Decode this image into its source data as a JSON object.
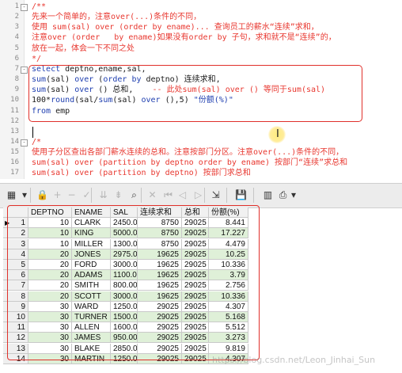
{
  "editor": {
    "lines": [
      {
        "n": "1",
        "fold": "-",
        "segments": [
          {
            "t": "/**",
            "c": "cm"
          }
        ]
      },
      {
        "n": "2",
        "segments": [
          {
            "t": "先来一个简单的，注意over(...)条件的不同，",
            "c": "cm"
          }
        ]
      },
      {
        "n": "3",
        "segments": [
          {
            "t": "使用 sum(sal) over (order by ename)... 查询员工的薪水“连续”求和，",
            "c": "cm"
          }
        ]
      },
      {
        "n": "4",
        "segments": [
          {
            "t": "注意over (order   by ename)如果没有order by 子句，求和就不是“连续”的，",
            "c": "cm"
          }
        ]
      },
      {
        "n": "5",
        "segments": [
          {
            "t": "放在一起，体会一下不同之处",
            "c": "cm"
          }
        ]
      },
      {
        "n": "6",
        "segments": [
          {
            "t": "*/",
            "c": "cm"
          }
        ]
      },
      {
        "n": "7",
        "fold": "-",
        "segments": [
          {
            "t": "select ",
            "c": "kw"
          },
          {
            "t": "deptno,ename,sal,",
            "c": "plain"
          }
        ]
      },
      {
        "n": "8",
        "segments": [
          {
            "t": "sum",
            "c": "fn"
          },
          {
            "t": "(sal) ",
            "c": "plain"
          },
          {
            "t": "over ",
            "c": "kw"
          },
          {
            "t": "(",
            "c": "plain"
          },
          {
            "t": "order by ",
            "c": "kw"
          },
          {
            "t": "deptno) 连续求和,",
            "c": "plain"
          }
        ]
      },
      {
        "n": "9",
        "segments": [
          {
            "t": "sum",
            "c": "fn"
          },
          {
            "t": "(sal) ",
            "c": "plain"
          },
          {
            "t": "over ",
            "c": "kw"
          },
          {
            "t": "() 总和,    ",
            "c": "plain"
          },
          {
            "t": "-- 此处sum(sal) over () 等同于sum(sal)",
            "c": "cm"
          }
        ]
      },
      {
        "n": "10",
        "segments": [
          {
            "t": "100*",
            "c": "plain"
          },
          {
            "t": "round",
            "c": "fn"
          },
          {
            "t": "(sal/",
            "c": "plain"
          },
          {
            "t": "sum",
            "c": "fn"
          },
          {
            "t": "(sal) ",
            "c": "plain"
          },
          {
            "t": "over ",
            "c": "kw"
          },
          {
            "t": "(),5) ",
            "c": "plain"
          },
          {
            "t": "\"份额(%)\"",
            "c": "str"
          }
        ]
      },
      {
        "n": "11",
        "segments": [
          {
            "t": "from ",
            "c": "kw"
          },
          {
            "t": "emp",
            "c": "plain"
          }
        ]
      },
      {
        "n": "12",
        "segments": []
      },
      {
        "n": "13",
        "segments": []
      },
      {
        "n": "14",
        "fold": "-",
        "segments": [
          {
            "t": "/*",
            "c": "cm"
          }
        ]
      },
      {
        "n": "15",
        "segments": [
          {
            "t": "使用子分区查出各部门薪水连续的总和。注意按部门分区。注意over(...)条件的不同，",
            "c": "cm"
          }
        ]
      },
      {
        "n": "16",
        "segments": [
          {
            "t": "sum(sal) over (partition by deptno order by ename) 按部门“连续”求总和",
            "c": "cm"
          }
        ]
      },
      {
        "n": "17",
        "segments": [
          {
            "t": "sum(sal) over (partition by deptno) 按部门求总和",
            "c": "cm"
          }
        ]
      }
    ]
  },
  "toolbar": {
    "buttons": [
      {
        "name": "grid-view-icon",
        "glyph": "▦",
        "enabled": true
      },
      {
        "name": "grid-view-dropdown-icon",
        "glyph": "▾",
        "enabled": true
      },
      {
        "name": "lock-icon",
        "glyph": "🔒",
        "enabled": false
      },
      {
        "name": "add-row-icon",
        "glyph": "+",
        "enabled": false
      },
      {
        "name": "delete-row-icon",
        "glyph": "−",
        "enabled": false
      },
      {
        "name": "post-changes-icon",
        "glyph": "✓",
        "enabled": false
      },
      {
        "name": "fetch-next-icon",
        "glyph": "⇊",
        "enabled": false
      },
      {
        "name": "fetch-all-icon",
        "glyph": "⇟",
        "enabled": false
      },
      {
        "name": "find-icon",
        "glyph": "⌕",
        "enabled": true
      },
      {
        "name": "clear-record-icon",
        "glyph": "✕",
        "enabled": false
      },
      {
        "name": "first-record-icon",
        "glyph": "⏮",
        "enabled": false
      },
      {
        "name": "prev-record-icon",
        "glyph": "◁",
        "enabled": false
      },
      {
        "name": "next-record-icon",
        "glyph": "▷",
        "enabled": false
      },
      {
        "name": "export-icon",
        "glyph": "⇲",
        "enabled": true
      },
      {
        "name": "save-icon",
        "glyph": "💾",
        "enabled": true
      },
      {
        "name": "chart-icon",
        "glyph": "▥",
        "enabled": true
      },
      {
        "name": "print-icon",
        "glyph": "⎙",
        "enabled": true
      },
      {
        "name": "print-dropdown-icon",
        "glyph": "▾",
        "enabled": true
      }
    ]
  },
  "grid": {
    "columns": [
      "",
      "DEPTNO",
      "ENAME",
      "SAL",
      "连续求和",
      "总和",
      "份额(%)"
    ],
    "rows": [
      {
        "i": "1",
        "cur": true,
        "deptno": "10",
        "ename": "CLARK",
        "sal": "2450.00",
        "cum": "8750",
        "total": "29025",
        "pct": "8.441"
      },
      {
        "i": "2",
        "deptno": "10",
        "ename": "KING",
        "sal": "5000.00",
        "cum": "8750",
        "total": "29025",
        "pct": "17.227"
      },
      {
        "i": "3",
        "deptno": "10",
        "ename": "MILLER",
        "sal": "1300.00",
        "cum": "8750",
        "total": "29025",
        "pct": "4.479"
      },
      {
        "i": "4",
        "deptno": "20",
        "ename": "JONES",
        "sal": "2975.00",
        "cum": "19625",
        "total": "29025",
        "pct": "10.25"
      },
      {
        "i": "5",
        "deptno": "20",
        "ename": "FORD",
        "sal": "3000.00",
        "cum": "19625",
        "total": "29025",
        "pct": "10.336"
      },
      {
        "i": "6",
        "deptno": "20",
        "ename": "ADAMS",
        "sal": "1100.00",
        "cum": "19625",
        "total": "29025",
        "pct": "3.79"
      },
      {
        "i": "7",
        "deptno": "20",
        "ename": "SMITH",
        "sal": "800.00",
        "cum": "19625",
        "total": "29025",
        "pct": "2.756"
      },
      {
        "i": "8",
        "deptno": "20",
        "ename": "SCOTT",
        "sal": "3000.00",
        "cum": "19625",
        "total": "29025",
        "pct": "10.336"
      },
      {
        "i": "9",
        "deptno": "30",
        "ename": "WARD",
        "sal": "1250.00",
        "cum": "29025",
        "total": "29025",
        "pct": "4.307"
      },
      {
        "i": "10",
        "deptno": "30",
        "ename": "TURNER",
        "sal": "1500.00",
        "cum": "29025",
        "total": "29025",
        "pct": "5.168"
      },
      {
        "i": "11",
        "deptno": "30",
        "ename": "ALLEN",
        "sal": "1600.00",
        "cum": "29025",
        "total": "29025",
        "pct": "5.512"
      },
      {
        "i": "12",
        "deptno": "30",
        "ename": "JAMES",
        "sal": "950.00",
        "cum": "29025",
        "total": "29025",
        "pct": "3.273"
      },
      {
        "i": "13",
        "deptno": "30",
        "ename": "BLAKE",
        "sal": "2850.00",
        "cum": "29025",
        "total": "29025",
        "pct": "9.819"
      },
      {
        "i": "14",
        "deptno": "30",
        "ename": "MARTIN",
        "sal": "1250.00",
        "cum": "29025",
        "total": "29025",
        "pct": "4.307"
      }
    ]
  },
  "watermark": "https://blog.csdn.net/Leon_Jinhai_Sun",
  "colors": {
    "comment": "#e8372f",
    "keyword": "#1f3fb0",
    "highlight_box": "#e0302a",
    "row_alt": "#dff0d8"
  }
}
